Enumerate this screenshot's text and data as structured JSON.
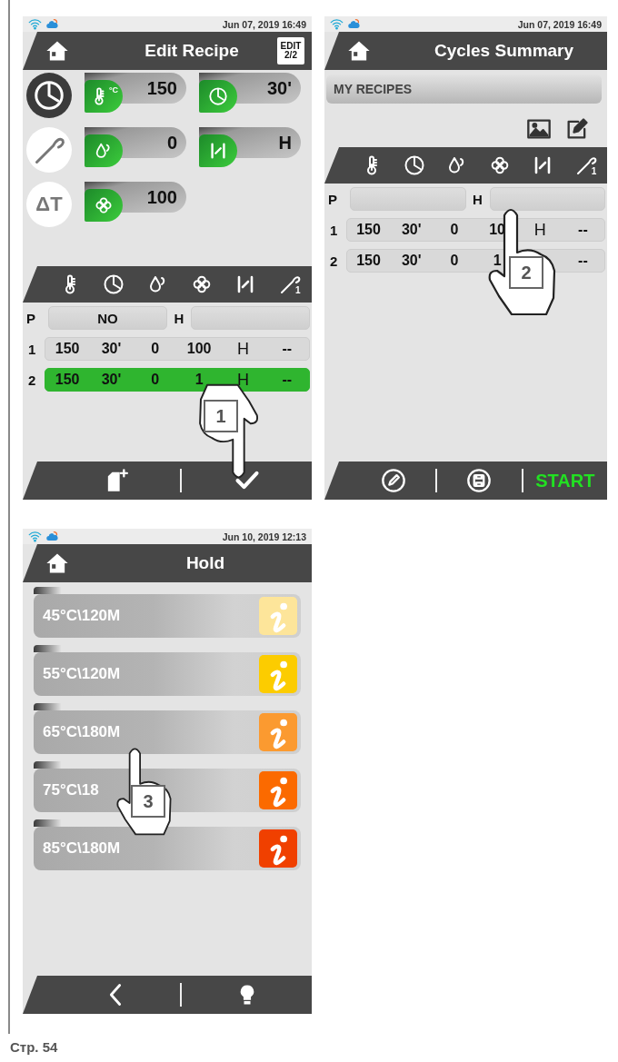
{
  "screens": [
    {
      "kind": "edit",
      "status_time": "Jun 07, 2019 16:49",
      "title": "Edit Recipe",
      "badge": [
        "EDIT",
        "2/2"
      ],
      "modes": [
        {
          "kind": "clock",
          "selected": true
        },
        {
          "kind": "probe",
          "selected": false
        },
        {
          "kind": "delta",
          "label": "ΔT",
          "selected": false
        }
      ],
      "params": [
        {
          "kind": "thermometer",
          "unit": "°C",
          "value": "150"
        },
        {
          "kind": "clock",
          "value": "30'"
        },
        {
          "kind": "drop",
          "value": "0"
        },
        {
          "kind": "vent",
          "value": "H"
        },
        {
          "kind": "fan",
          "value": "100"
        }
      ],
      "table": {
        "headers": [
          {
            "kind": "thermometer"
          },
          {
            "kind": "clock"
          },
          {
            "kind": "drop"
          },
          {
            "kind": "fan"
          },
          {
            "kind": "vent"
          },
          {
            "kind": "probe",
            "label": "1"
          }
        ],
        "p_row": {
          "label": "P",
          "value": "NO",
          "h_label": "H"
        },
        "rows": [
          {
            "index": "1",
            "selected": false,
            "cells": [
              "150",
              "30'",
              "0",
              "100",
              "H",
              "--"
            ]
          },
          {
            "index": "2",
            "selected": true,
            "cells": [
              "150",
              "30'",
              "0",
              "1",
              "H",
              "--"
            ]
          }
        ]
      },
      "toolbar": [
        {
          "kind": "new-file"
        },
        {
          "kind": "check"
        }
      ],
      "pointer": {
        "number": "1",
        "kind": "down"
      }
    },
    {
      "kind": "summary",
      "status_time": "Jun 07, 2019 16:49",
      "title": "Cycles Summary",
      "section": "MY RECIPES",
      "actions": [
        {
          "kind": "image"
        },
        {
          "kind": "edit"
        }
      ],
      "table": {
        "headers": [
          {
            "kind": "thermometer"
          },
          {
            "kind": "clock"
          },
          {
            "kind": "drop"
          },
          {
            "kind": "fan"
          },
          {
            "kind": "vent"
          },
          {
            "kind": "probe",
            "label": "1"
          }
        ],
        "p_row": {
          "label": "P",
          "h_label": "H"
        },
        "rows": [
          {
            "index": "1",
            "selected": false,
            "cells": [
              "150",
              "30'",
              "0",
              "10",
              "H",
              "--"
            ]
          },
          {
            "index": "2",
            "selected": false,
            "cells": [
              "150",
              "30'",
              "0",
              "1",
              null,
              "--"
            ]
          }
        ]
      },
      "toolbar": [
        {
          "kind": "pencil-circle"
        },
        {
          "kind": "save-circle"
        },
        {
          "kind": "text",
          "label": "START"
        }
      ],
      "pointer": {
        "number": "2",
        "kind": "up"
      }
    },
    {
      "kind": "hold",
      "status_time": "Jun 10, 2019 12:13",
      "title": "Hold",
      "items": [
        {
          "label": "45°C\\120M",
          "color": "#fde59a"
        },
        {
          "label": "55°C\\120M",
          "color": "#fccc00"
        },
        {
          "label": "65°C\\180M",
          "color": "#fb9a30"
        },
        {
          "label": "75°C\\18",
          "color": "#fb6a00"
        },
        {
          "label": "85°C\\180M",
          "color": "#f04000"
        }
      ],
      "toolbar": [
        {
          "kind": "back"
        },
        {
          "kind": "bulb"
        }
      ],
      "pointer": {
        "number": "3",
        "kind": "up"
      }
    }
  ],
  "page_label": "Стр. 54"
}
